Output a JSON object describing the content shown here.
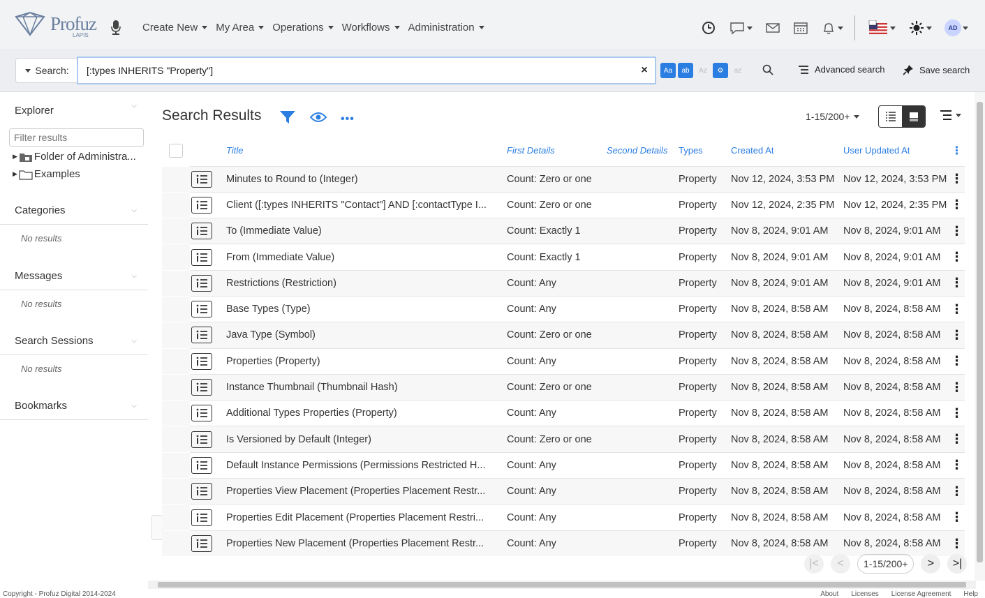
{
  "brand": {
    "logo_text": "Profuz",
    "logo_sub": "LAPIS"
  },
  "nav": [
    "Create New",
    "My Area",
    "Operations",
    "Workflows",
    "Administration"
  ],
  "user": {
    "initials": "AD",
    "flag_label": "en"
  },
  "search": {
    "label": "Search:",
    "value": "[:types INHERITS \"Property\"]",
    "clear": "×",
    "opts": [
      "Aa",
      "ab",
      "Az",
      "⚙",
      "az"
    ],
    "advanced": "Advanced search",
    "save": "Save search"
  },
  "sidebar": {
    "explorer": "Explorer",
    "filter_placeholder": "Filter results",
    "tree": [
      "Folder of Administra...",
      "Examples"
    ],
    "sections": [
      {
        "title": "Categories",
        "empty": "No results"
      },
      {
        "title": "Messages",
        "empty": "No results"
      },
      {
        "title": "Search Sessions",
        "empty": "No results"
      },
      {
        "title": "Bookmarks",
        "empty": ""
      }
    ]
  },
  "results": {
    "title": "Search Results",
    "paging": "1-15/200+",
    "columns": [
      "Title",
      "First Details",
      "Second Details",
      "Types",
      "Created At",
      "User Updated At"
    ],
    "rows": [
      {
        "title": "Minutes to Round to (Integer)",
        "first": "Count: Zero or one",
        "second": "",
        "type": "Property",
        "created": "Nov 12, 2024, 3:53 PM",
        "updated": "Nov 12, 2024, 3:53 PM"
      },
      {
        "title": "Client ([:types INHERITS \"Contact\"] AND [:contactType I...",
        "first": "Count: Zero or one",
        "second": "",
        "type": "Property",
        "created": "Nov 12, 2024, 2:35 PM",
        "updated": "Nov 12, 2024, 2:35 PM"
      },
      {
        "title": "To (Immediate Value)",
        "first": "Count: Exactly 1",
        "second": "",
        "type": "Property",
        "created": "Nov 8, 2024, 9:01 AM",
        "updated": "Nov 8, 2024, 9:01 AM"
      },
      {
        "title": "From (Immediate Value)",
        "first": "Count: Exactly 1",
        "second": "",
        "type": "Property",
        "created": "Nov 8, 2024, 9:01 AM",
        "updated": "Nov 8, 2024, 9:01 AM"
      },
      {
        "title": "Restrictions (Restriction)",
        "first": "Count: Any",
        "second": "",
        "type": "Property",
        "created": "Nov 8, 2024, 9:01 AM",
        "updated": "Nov 8, 2024, 9:01 AM"
      },
      {
        "title": "Base Types (Type)",
        "first": "Count: Any",
        "second": "",
        "type": "Property",
        "created": "Nov 8, 2024, 8:58 AM",
        "updated": "Nov 8, 2024, 8:58 AM"
      },
      {
        "title": "Java Type (Symbol)",
        "first": "Count: Zero or one",
        "second": "",
        "type": "Property",
        "created": "Nov 8, 2024, 8:58 AM",
        "updated": "Nov 8, 2024, 8:58 AM"
      },
      {
        "title": "Properties (Property)",
        "first": "Count: Any",
        "second": "",
        "type": "Property",
        "created": "Nov 8, 2024, 8:58 AM",
        "updated": "Nov 8, 2024, 8:58 AM"
      },
      {
        "title": "Instance Thumbnail (Thumbnail Hash)",
        "first": "Count: Zero or one",
        "second": "",
        "type": "Property",
        "created": "Nov 8, 2024, 8:58 AM",
        "updated": "Nov 8, 2024, 8:58 AM"
      },
      {
        "title": "Additional Types Properties (Property)",
        "first": "Count: Any",
        "second": "",
        "type": "Property",
        "created": "Nov 8, 2024, 8:58 AM",
        "updated": "Nov 8, 2024, 8:58 AM"
      },
      {
        "title": "Is Versioned by Default (Integer)",
        "first": "Count: Zero or one",
        "second": "",
        "type": "Property",
        "created": "Nov 8, 2024, 8:58 AM",
        "updated": "Nov 8, 2024, 8:58 AM"
      },
      {
        "title": "Default Instance Permissions (Permissions Restricted H...",
        "first": "Count: Any",
        "second": "",
        "type": "Property",
        "created": "Nov 8, 2024, 8:58 AM",
        "updated": "Nov 8, 2024, 8:58 AM"
      },
      {
        "title": "Properties View Placement (Properties Placement Restr...",
        "first": "Count: Any",
        "second": "",
        "type": "Property",
        "created": "Nov 8, 2024, 8:58 AM",
        "updated": "Nov 8, 2024, 8:58 AM"
      },
      {
        "title": "Properties Edit Placement (Properties Placement Restri...",
        "first": "Count: Any",
        "second": "",
        "type": "Property",
        "created": "Nov 8, 2024, 8:58 AM",
        "updated": "Nov 8, 2024, 8:58 AM"
      },
      {
        "title": "Properties New Placement (Properties Placement Restr...",
        "first": "Count: Any",
        "second": "",
        "type": "Property",
        "created": "Nov 8, 2024, 8:58 AM",
        "updated": "Nov 8, 2024, 8:58 AM"
      }
    ]
  },
  "pager": {
    "first": "|<",
    "prev": "<",
    "page": "1-15/200+",
    "next": ">",
    "last": ">|"
  },
  "footer": {
    "copyright": "Copyright - Profuz Digital 2014-2024",
    "links": [
      "About",
      "Licenses",
      "License Agreement",
      "Help"
    ]
  },
  "colors": {
    "accent": "#2a7de1",
    "topbar": "#f1f3f5"
  }
}
